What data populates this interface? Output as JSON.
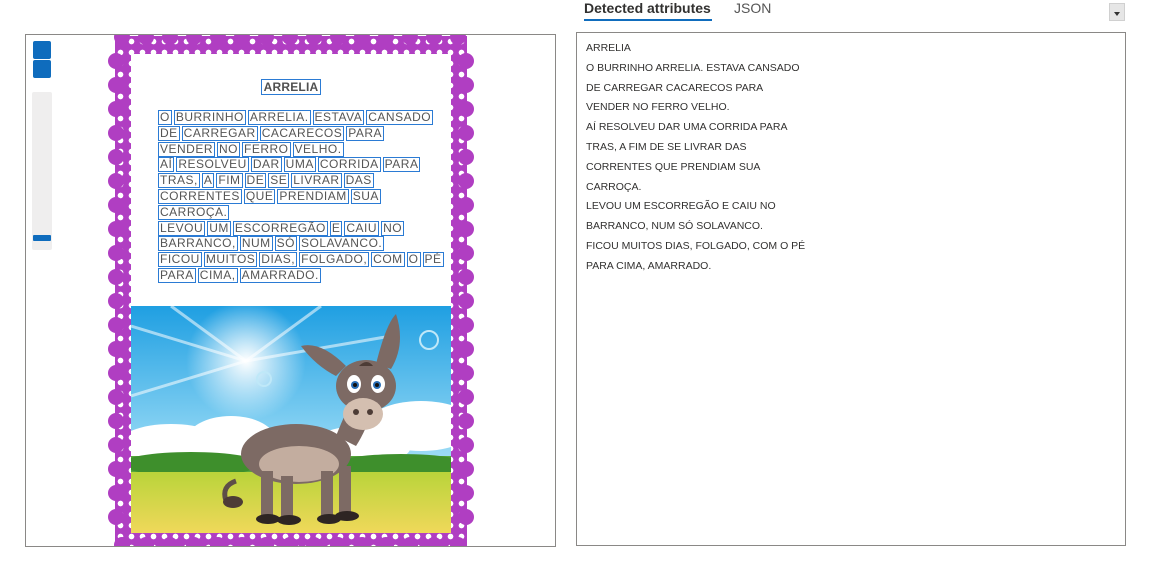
{
  "viewer": {
    "controls": [
      "zoom-in",
      "zoom-out",
      "zoom-slider"
    ],
    "zoom_level": 0.1
  },
  "document": {
    "title": "ARRELIA",
    "lines": [
      [
        "O",
        "BURRINHO",
        "ARRELIA.",
        "ESTAVA",
        "CANSADO"
      ],
      [
        "DE",
        "CARREGAR",
        "CACARECOS",
        "PARA"
      ],
      [
        "VENDER",
        "NO",
        "FERRO",
        "VELHO."
      ],
      [
        "AÍ",
        "RESOLVEU",
        "DAR",
        "UMA",
        "CORRIDA",
        "PARA"
      ],
      [
        "TRAS,",
        "A",
        "FIM",
        "DE",
        "SE",
        "LIVRAR",
        "DAS"
      ],
      [
        "CORRENTES",
        "QUE",
        "PRENDIAM",
        "SUA"
      ],
      [
        "CARROÇA."
      ],
      [
        "LEVOU",
        "UM",
        "ESCORREGÃO",
        "E",
        "CAIU",
        "NO"
      ],
      [
        "BARRANCO,",
        "NUM",
        "SÓ",
        "SOLAVANCO."
      ],
      [
        "FICOU",
        "MUITOS",
        "DIAS,",
        "FOLGADO,",
        "COM",
        "O",
        "PÉ"
      ],
      [
        "PARA",
        "CIMA,",
        "AMARRADO."
      ]
    ],
    "colors": {
      "frame": "#b03ec2",
      "box": "#2b7bd4"
    }
  },
  "tabs": [
    {
      "label": "Detected attributes",
      "active": true
    },
    {
      "label": "JSON",
      "active": false
    }
  ],
  "results": {
    "lines": [
      "ARRELIA",
      "O BURRINHO ARRELIA. ESTAVA CANSADO",
      "DE CARREGAR CACARECOS PARA",
      "VENDER NO FERRO VELHO.",
      "AÍ RESOLVEU DAR UMA CORRIDA PARA",
      "TRAS, A FIM DE SE LIVRAR DAS",
      "CORRENTES QUE PRENDIAM SUA",
      "CARROÇA.",
      "LEVOU UM ESCORREGÃO E CAIU NO",
      "BARRANCO, NUM SÓ SOLAVANCO.",
      "FICOU MUITOS DIAS, FOLGADO, COM O PÉ",
      "PARA CIMA, AMARRADO."
    ]
  }
}
